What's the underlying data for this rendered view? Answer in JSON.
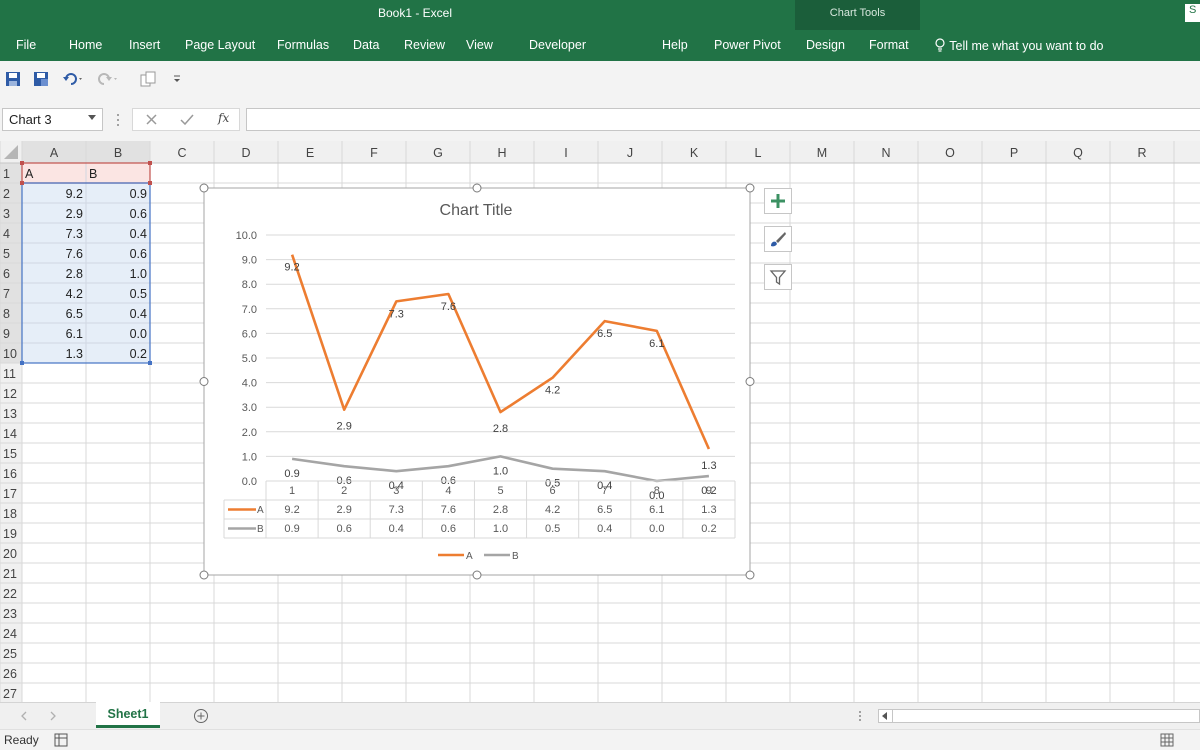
{
  "app": {
    "window_title": "Book1  -  Excel",
    "contextual_group": "Chart Tools",
    "signin_label": "S",
    "accent": "#217346"
  },
  "ribbon": {
    "tabs": [
      "File",
      "Home",
      "Insert",
      "Page Layout",
      "Formulas",
      "Data",
      "Review",
      "View",
      "Developer",
      "Help",
      "Power Pivot",
      "Design",
      "Format"
    ],
    "tell_me": "Tell me what you want to do"
  },
  "qat": {
    "icons": [
      "save-icon",
      "save-as-icon",
      "undo-icon",
      "redo-icon",
      "copy-icon",
      "customize-icon"
    ]
  },
  "formula_bar": {
    "name_box": "Chart 3",
    "fx_label": "fx",
    "value": ""
  },
  "sheet": {
    "columns": [
      "A",
      "B",
      "C",
      "D",
      "E",
      "F",
      "G",
      "H",
      "I",
      "J",
      "K",
      "L",
      "M",
      "N",
      "O",
      "P",
      "Q",
      "R"
    ],
    "rows": [
      "1",
      "2",
      "3",
      "4",
      "5",
      "6",
      "7",
      "8",
      "9",
      "10",
      "11",
      "12",
      "13",
      "14",
      "15",
      "16",
      "17",
      "18",
      "19",
      "20",
      "21",
      "22",
      "23",
      "24",
      "25",
      "26",
      "27"
    ],
    "header_row": [
      "A",
      "B"
    ],
    "col_a": [
      "9.2",
      "2.9",
      "7.3",
      "7.6",
      "2.8",
      "4.2",
      "6.5",
      "6.1",
      "1.3"
    ],
    "col_b": [
      "0.9",
      "0.6",
      "0.4",
      "0.6",
      "1.0",
      "0.5",
      "0.4",
      "0.0",
      "0.2"
    ]
  },
  "chart_data": {
    "type": "line",
    "title": "Chart Title",
    "categories": [
      "1",
      "2",
      "3",
      "4",
      "5",
      "6",
      "7",
      "8",
      "9"
    ],
    "series": [
      {
        "name": "A",
        "values": [
          9.2,
          2.9,
          7.3,
          7.6,
          2.8,
          4.2,
          6.5,
          6.1,
          1.3
        ],
        "color": "#ed7d31"
      },
      {
        "name": "B",
        "values": [
          0.9,
          0.6,
          0.4,
          0.6,
          1.0,
          0.5,
          0.4,
          0.0,
          0.2
        ],
        "color": "#a5a5a5"
      }
    ],
    "y_ticks": [
      "0.0",
      "1.0",
      "2.0",
      "3.0",
      "4.0",
      "5.0",
      "6.0",
      "7.0",
      "8.0",
      "9.0",
      "10.0"
    ],
    "ylim": [
      0,
      10
    ],
    "data_labels": true,
    "data_table": true,
    "legend": "bottom",
    "grid": true
  },
  "chart_side_buttons": [
    "chart-elements-icon",
    "chart-styles-icon",
    "chart-filters-icon"
  ],
  "sheet_tabs": [
    "Sheet1"
  ],
  "status": {
    "text": "Ready"
  }
}
